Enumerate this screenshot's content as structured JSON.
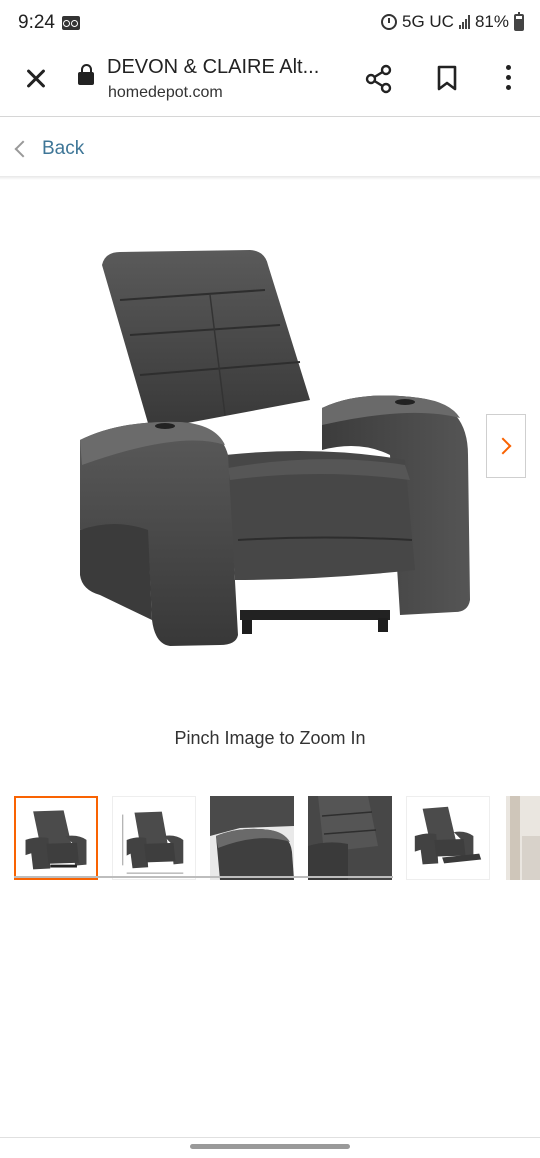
{
  "status_bar": {
    "time": "9:24",
    "network": "5G UC",
    "battery": "81%",
    "icons": [
      "voicemail-icon",
      "alarm-icon",
      "signal-icon",
      "battery-icon"
    ]
  },
  "browser": {
    "page_title": "DEVON & CLAIRE Alt...",
    "domain": "homedepot.com",
    "icons": [
      "close-icon",
      "lock-icon",
      "share-icon",
      "bookmark-icon",
      "more-vert-icon"
    ]
  },
  "nav": {
    "back_label": "Back"
  },
  "product_gallery": {
    "hint": "Pinch Image to Zoom In",
    "accent_color": "#f96302",
    "selected_index": 0,
    "thumbnails": [
      {
        "icon": "recliner-front-thumbnail"
      },
      {
        "icon": "recliner-dimensions-thumbnail"
      },
      {
        "icon": "armrest-closeup-thumbnail"
      },
      {
        "icon": "backrest-closeup-thumbnail"
      },
      {
        "icon": "recliner-reclined-thumbnail"
      },
      {
        "icon": "room-scene-thumbnail"
      }
    ]
  }
}
